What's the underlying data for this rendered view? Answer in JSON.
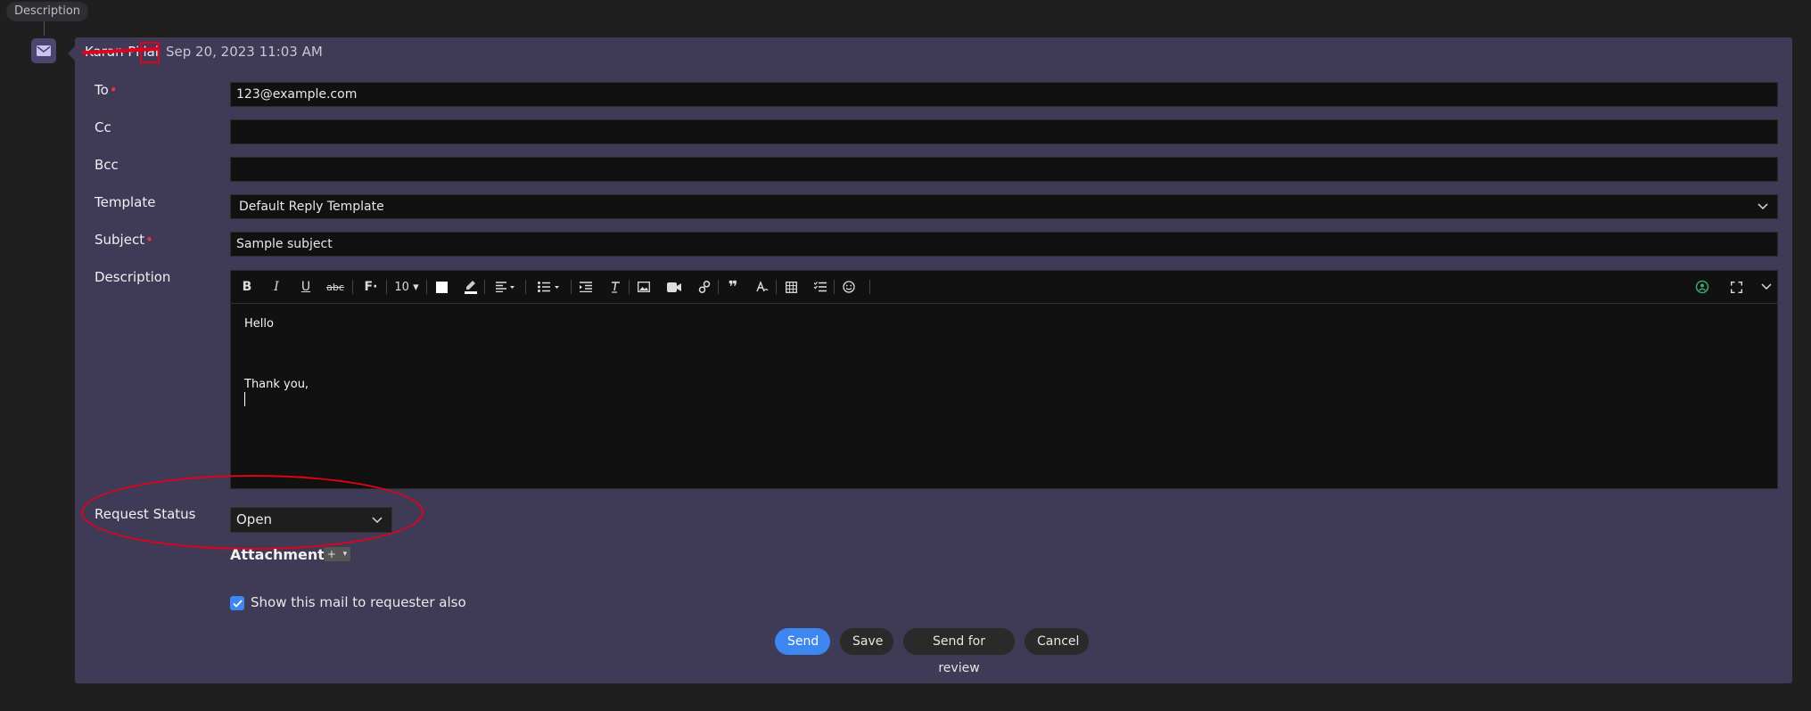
{
  "header": {
    "tag": "Description",
    "author": "Karan Pillai",
    "timestamp": "Sep 20, 2023 11:03 AM"
  },
  "form": {
    "to": {
      "label": "To",
      "value": "123@example.com"
    },
    "cc": {
      "label": "Cc",
      "value": ""
    },
    "bcc": {
      "label": "Bcc",
      "value": ""
    },
    "template": {
      "label": "Template",
      "value": "Default Reply Template"
    },
    "subject": {
      "label": "Subject",
      "value": "Sample subject"
    },
    "description": {
      "label": "Description",
      "font_size": "10",
      "body_line1": "Hello",
      "body_line2": "Thank you,"
    },
    "request_status": {
      "label": "Request Status",
      "value": "Open"
    },
    "attachments": {
      "label": "Attachments"
    },
    "show_to_requester": {
      "label": "Show this mail to requester also",
      "checked": true
    }
  },
  "actions": {
    "send": "Send",
    "save": "Save",
    "send_for_review": "Send for review",
    "cancel": "Cancel"
  },
  "colors": {
    "panel": "#3f3a56",
    "primary": "#3e86f0",
    "required": "#e23a3a",
    "annotation": "#e4001a"
  }
}
